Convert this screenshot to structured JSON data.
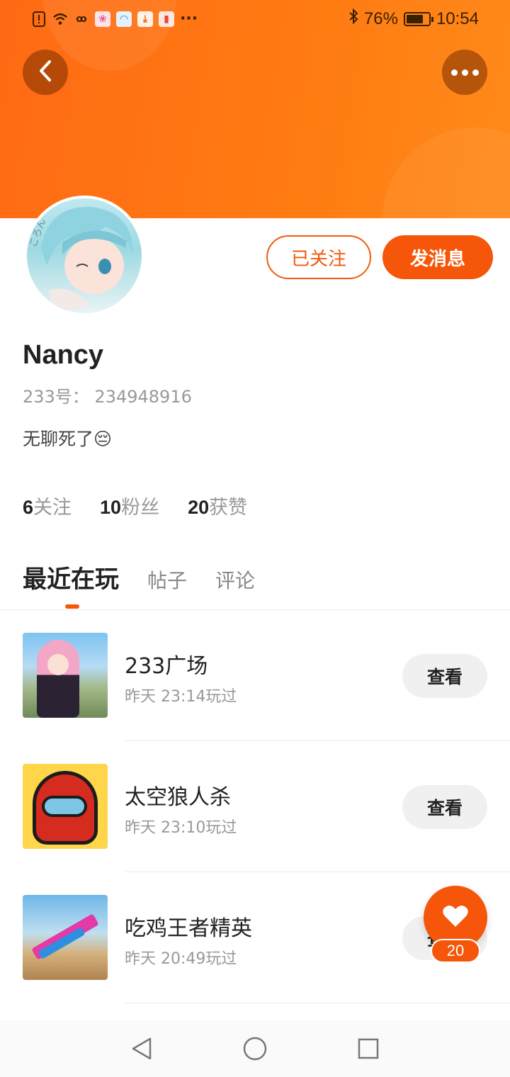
{
  "status_bar": {
    "battery_percent": "76%",
    "battery_level": 0.76,
    "time": "10:54",
    "more_notifications": "···",
    "icons": [
      "alert-icon",
      "wifi-icon",
      "app-icon",
      "flower-app-icon",
      "browser-app-icon",
      "download-icon",
      "book-app-icon",
      "bluetooth-icon",
      "battery-icon"
    ]
  },
  "header": {
    "back_icon": "chevron-left-icon",
    "more_icon": "more-horizontal-icon",
    "gradient_colors": [
      "#ff6a14",
      "#ff8a1a"
    ]
  },
  "profile": {
    "follow_label": "已关注",
    "message_label": "发消息",
    "name": "Nancy",
    "id_text": "233号： 234948916",
    "bio": "无聊死了😔",
    "stats": [
      {
        "num": "6",
        "label": "关注"
      },
      {
        "num": "10",
        "label": "粉丝"
      },
      {
        "num": "20",
        "label": "获赞"
      }
    ]
  },
  "tabs": [
    {
      "label": "最近在玩",
      "active": true
    },
    {
      "label": "帖子",
      "active": false
    },
    {
      "label": "评论",
      "active": false
    }
  ],
  "games": [
    {
      "title": "233广场",
      "time": "昨天 23:14玩过",
      "button": "查看"
    },
    {
      "title": "太空狼人杀",
      "time": "昨天 23:10玩过",
      "button": "查看"
    },
    {
      "title": "吃鸡王者精英",
      "time": "昨天 20:49玩过",
      "button": "查看"
    }
  ],
  "like_fab": {
    "count": "20",
    "icon": "heart-icon"
  },
  "accent_color": "#f5560a",
  "nav_bar": {
    "icons": [
      "back-triangle-icon",
      "home-circle-icon",
      "recents-square-icon"
    ]
  }
}
